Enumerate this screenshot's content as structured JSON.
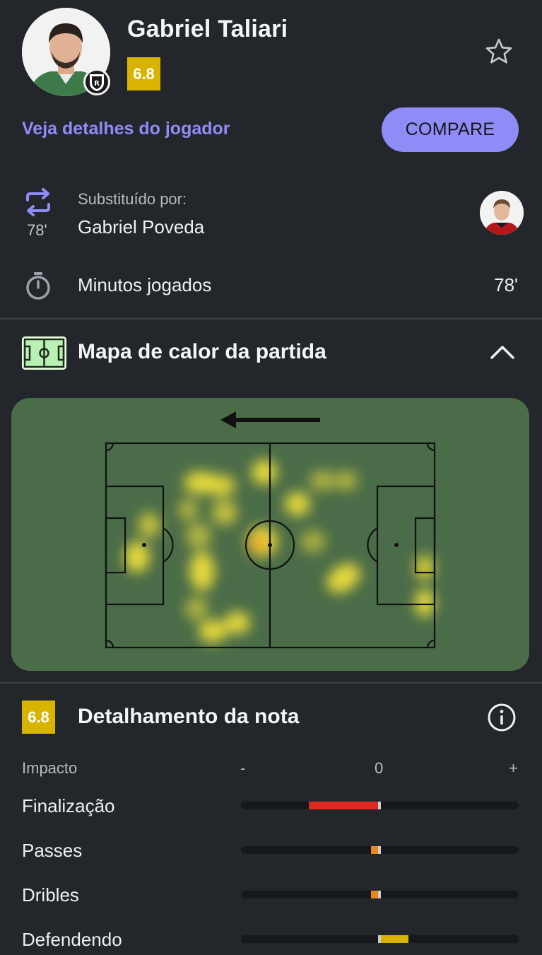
{
  "header": {
    "player_name": "Gabriel Taliari",
    "rating": "6.8",
    "details_link": "Veja detalhes do jogador",
    "compare_button": "COMPARE",
    "star_icon": "star-outline-icon"
  },
  "substitution": {
    "label": "Substituído por:",
    "player": "Gabriel Poveda",
    "minute": "78'",
    "icon": "swap-icon"
  },
  "minutes": {
    "label": "Minutos jogados",
    "value": "78'",
    "icon": "stopwatch-icon"
  },
  "heatmap": {
    "title": "Mapa de calor da partida",
    "icon": "pitch-icon",
    "attack_direction": "left",
    "collapse_icon": "chevron-up-icon"
  },
  "breakdown": {
    "rating": "6.8",
    "title": "Detalhamento da nota",
    "info_icon": "info-icon",
    "impact_label": "Impacto",
    "scale": {
      "minus": "-",
      "zero": "0",
      "plus": "+"
    },
    "metrics": [
      {
        "label": "Finalização",
        "impact": -0.51,
        "color": "#e0281e"
      },
      {
        "label": "Passes",
        "impact": -0.06,
        "color": "#e8871e"
      },
      {
        "label": "Dribles",
        "impact": -0.06,
        "color": "#e8871e"
      },
      {
        "label": "Defendendo",
        "impact": 0.2,
        "color": "#d8b400"
      }
    ]
  },
  "colors": {
    "background": "#23262b",
    "accent": "#8f8cf7",
    "rating_badge": "#d8b400",
    "pitch": "#4a6c48"
  }
}
